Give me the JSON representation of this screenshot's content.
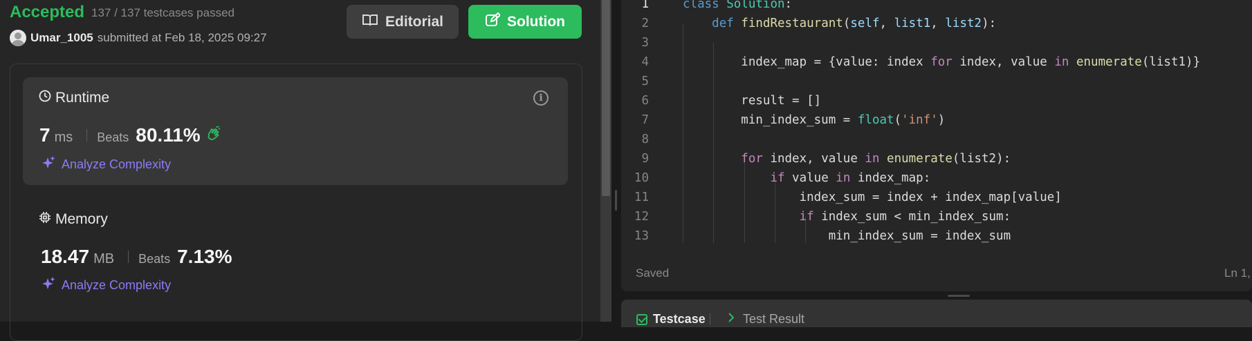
{
  "submission": {
    "status": "Accepted",
    "testcases": "137 / 137 testcases passed",
    "username": "Umar_1005",
    "submitted_text": "submitted at Feb 18, 2025 09:27",
    "editorial_label": "Editorial",
    "solution_label": "Solution"
  },
  "runtime": {
    "title": "Runtime",
    "value": "7",
    "unit": "ms",
    "beats_label": "Beats",
    "beats_value": "80.11%",
    "analyze_label": "Analyze Complexity"
  },
  "memory": {
    "title": "Memory",
    "value": "18.47",
    "unit": "MB",
    "beats_label": "Beats",
    "beats_value": "7.13%",
    "analyze_label": "Analyze Complexity"
  },
  "editor": {
    "line_numbers": [
      "1",
      "2",
      "3",
      "4",
      "5",
      "6",
      "7",
      "8",
      "9",
      "10",
      "11",
      "12",
      "13"
    ],
    "saved_label": "Saved",
    "cursor_position": "Ln 1,"
  },
  "bottom_panel": {
    "testcase_tab": "Testcase",
    "result_tab": "Test Result"
  },
  "colors": {
    "accepted": "#2cbb5d",
    "analyze": "#8b7cf6",
    "background": "#262626"
  }
}
